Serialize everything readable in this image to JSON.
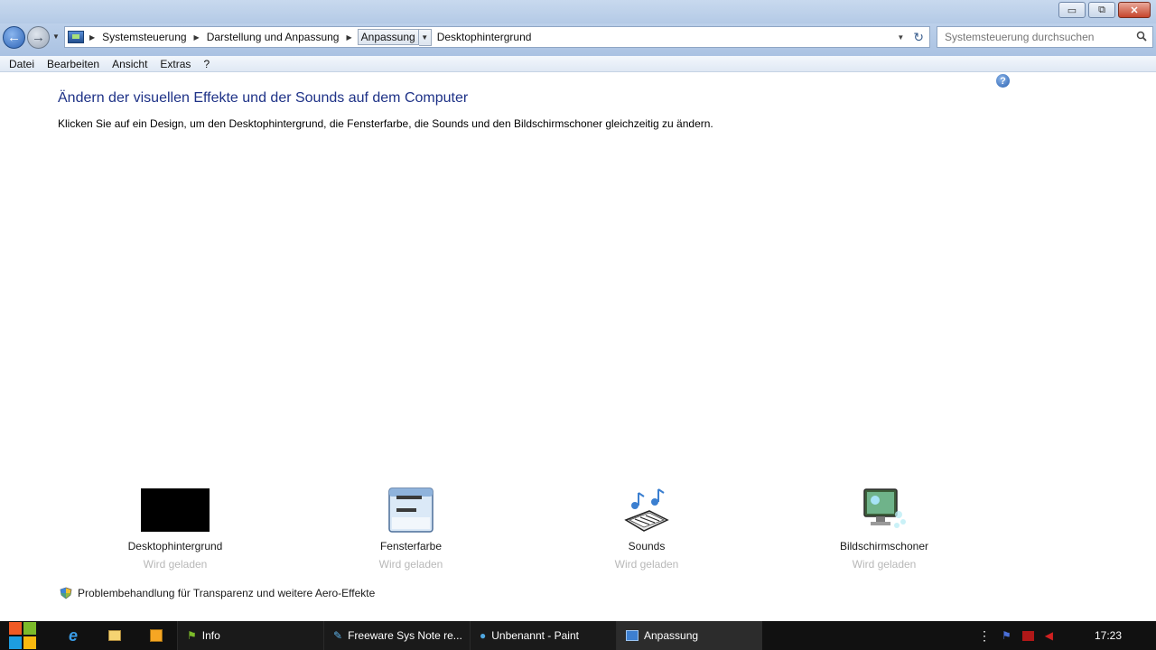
{
  "window": {
    "controls": {
      "minimize": "▭",
      "maximize": "⧉",
      "close": "✕"
    }
  },
  "navigation": {
    "breadcrumbs": [
      "Systemsteuerung",
      "Darstellung und Anpassung",
      "Anpassung",
      "Desktophintergrund"
    ],
    "search_placeholder": "Systemsteuerung durchsuchen"
  },
  "menu": [
    "Datei",
    "Bearbeiten",
    "Ansicht",
    "Extras",
    "?"
  ],
  "main": {
    "title": "Ändern der visuellen Effekte und der Sounds auf dem Computer",
    "description": "Klicken Sie auf ein Design, um den Desktophintergrund, die Fensterfarbe, die Sounds und den Bildschirmschoner gleichzeitig zu ändern.",
    "tiles": [
      {
        "label": "Desktophintergrund",
        "status": "Wird geladen"
      },
      {
        "label": "Fensterfarbe",
        "status": "Wird geladen"
      },
      {
        "label": "Sounds",
        "status": "Wird geladen"
      },
      {
        "label": "Bildschirmschoner",
        "status": "Wird geladen"
      }
    ],
    "troubleshoot": "Problembehandlung für Transparenz und weitere Aero-Effekte"
  },
  "taskbar": {
    "tasks": [
      "Info",
      "Freeware Sys Note re...",
      "Unbenannt - Paint",
      "Anpassung"
    ],
    "clock": "17:23"
  },
  "colors": {
    "title_blue": "#1e3287",
    "status_grey": "#b8b8b8",
    "taskbar": "#111111"
  }
}
